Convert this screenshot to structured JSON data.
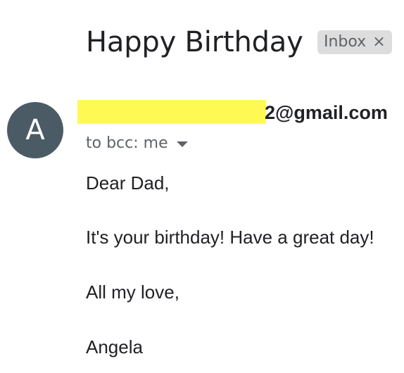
{
  "message": {
    "subject": "Happy Birthday",
    "label": {
      "text": "Inbox",
      "close_symbol": "×"
    },
    "avatar_initial": "A",
    "sender_visible_text": "2@gmail.com",
    "recipient_text": "to bcc: me",
    "body_lines": [
      "Dear Dad,",
      "It's your birthday! Have a great day!",
      "All my love,",
      "Angela"
    ]
  },
  "colors": {
    "avatar_bg": "#4b5b66",
    "redaction": "#fff954",
    "label_bg": "#dddddd",
    "secondary_text": "#5f6368",
    "primary_text": "#202124"
  },
  "icons": {
    "recipient_details": "caret-down-icon",
    "label_remove": "close-icon"
  }
}
